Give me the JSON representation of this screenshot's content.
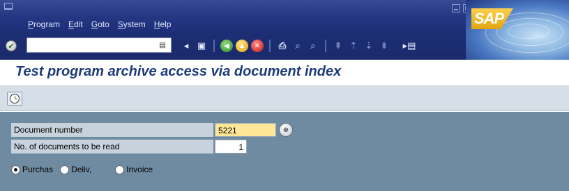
{
  "menubar": {
    "items": [
      {
        "label": "Program",
        "mnemonic": "P",
        "rest": "rogram"
      },
      {
        "label": "Edit",
        "mnemonic": "E",
        "rest": "dit"
      },
      {
        "label": "Goto",
        "mnemonic": "G",
        "rest": "oto"
      },
      {
        "label": "System",
        "mnemonic": "S",
        "rest": "ystem"
      },
      {
        "label": "Help",
        "mnemonic": "H",
        "rest": "elp"
      }
    ],
    "brand": "SAP"
  },
  "toolbar": {
    "command_field_value": "",
    "icons": [
      "enter-icon",
      "save-icon",
      "back-icon",
      "exit-icon",
      "cancel-icon",
      "print-icon",
      "find-icon",
      "find-next-icon",
      "first-page-icon",
      "previous-page-icon",
      "next-page-icon",
      "last-page-icon",
      "create-session-icon"
    ]
  },
  "title": "Test program archive access via document index",
  "app_toolbar": {
    "execute_icon": "execute-icon"
  },
  "form": {
    "document_number": {
      "label": "Document number",
      "value": "5221"
    },
    "documents_to_read": {
      "label": "No. of documents to be read",
      "value": "1"
    },
    "radios": [
      {
        "label": "Purchas",
        "selected": true
      },
      {
        "label": "Deliv,",
        "selected": false
      },
      {
        "label": "Invoice",
        "selected": false
      }
    ]
  },
  "colors": {
    "menubar_bg": "#243682",
    "title_text": "#1d3b7a",
    "work_area_bg": "#6f8ba1",
    "focus_field_bg": "#ffe797"
  }
}
